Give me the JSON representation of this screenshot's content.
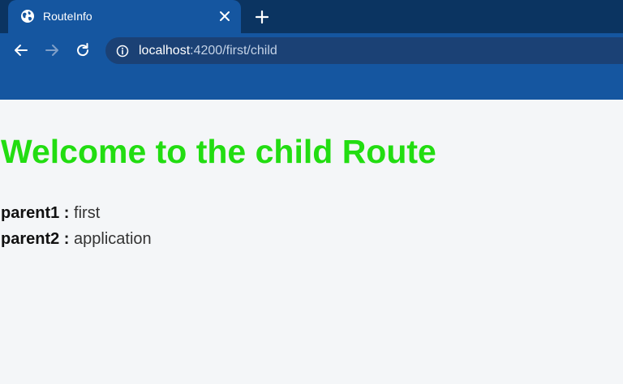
{
  "browser": {
    "tab": {
      "title": "RouteInfo",
      "icon": "globe-icon"
    },
    "url": {
      "host": "localhost",
      "rest": ":4200/first/child"
    },
    "colors": {
      "topbar": "#0b3461",
      "toolbar": "#1556a0",
      "omnibox": "#1b4175"
    }
  },
  "page": {
    "heading": "Welcome to the child Route",
    "heading_color": "#22dd11",
    "params": [
      {
        "key": "parent1 :",
        "value": "first"
      },
      {
        "key": "parent2 :",
        "value": "application"
      }
    ]
  }
}
